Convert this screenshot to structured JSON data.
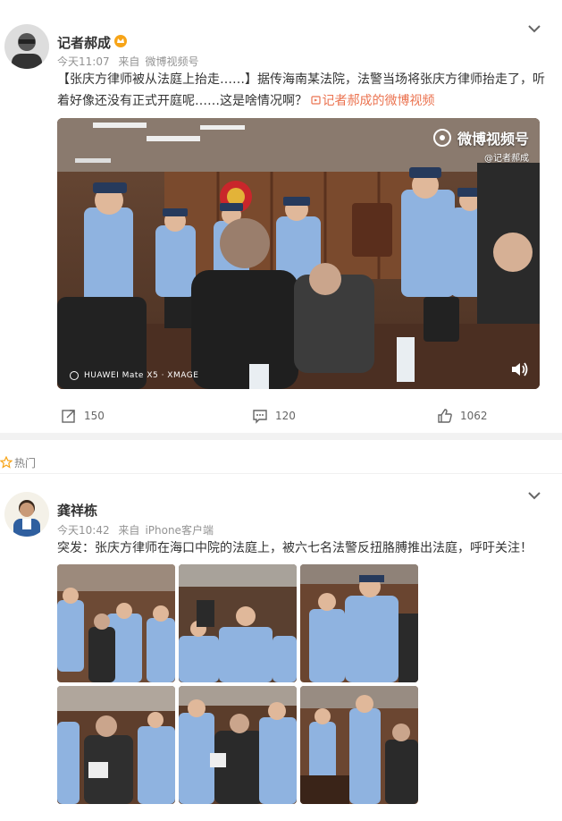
{
  "post1": {
    "username": "记者郝成",
    "time": "今天11:07",
    "source_prefix": "来自",
    "source": "微博视频号",
    "text": "【张庆方律师被从法庭上抬走……】据传海南某法院，法警当场将张庆方律师抬走了，听着好像还没有正式开庭呢……这是啥情况啊？",
    "link_text": "记者郝成的微博视频",
    "video": {
      "watermark": "微博视频号",
      "watermark_sub": "@记者郝成",
      "camera_tag": "HUAWEI Mate X5 · XMAGE"
    },
    "actions": {
      "repost_count": "150",
      "comment_count": "120",
      "like_count": "1062"
    }
  },
  "hot_section": {
    "label": "热门"
  },
  "post2": {
    "username": "龚祥栋",
    "time": "今天10:42",
    "source_prefix": "来自",
    "source": "iPhone客户端",
    "text": "突发：张庆方律师在海口中院的法庭上，被六七名法警反扭胳膊推出法庭，呼吁关注！",
    "images_count": 6
  },
  "colors": {
    "link": "#eb7350",
    "vip_badge": "#f7a417",
    "police_shirt": "#8fb3e0",
    "courtroom_wood": "#7a4a2d"
  }
}
